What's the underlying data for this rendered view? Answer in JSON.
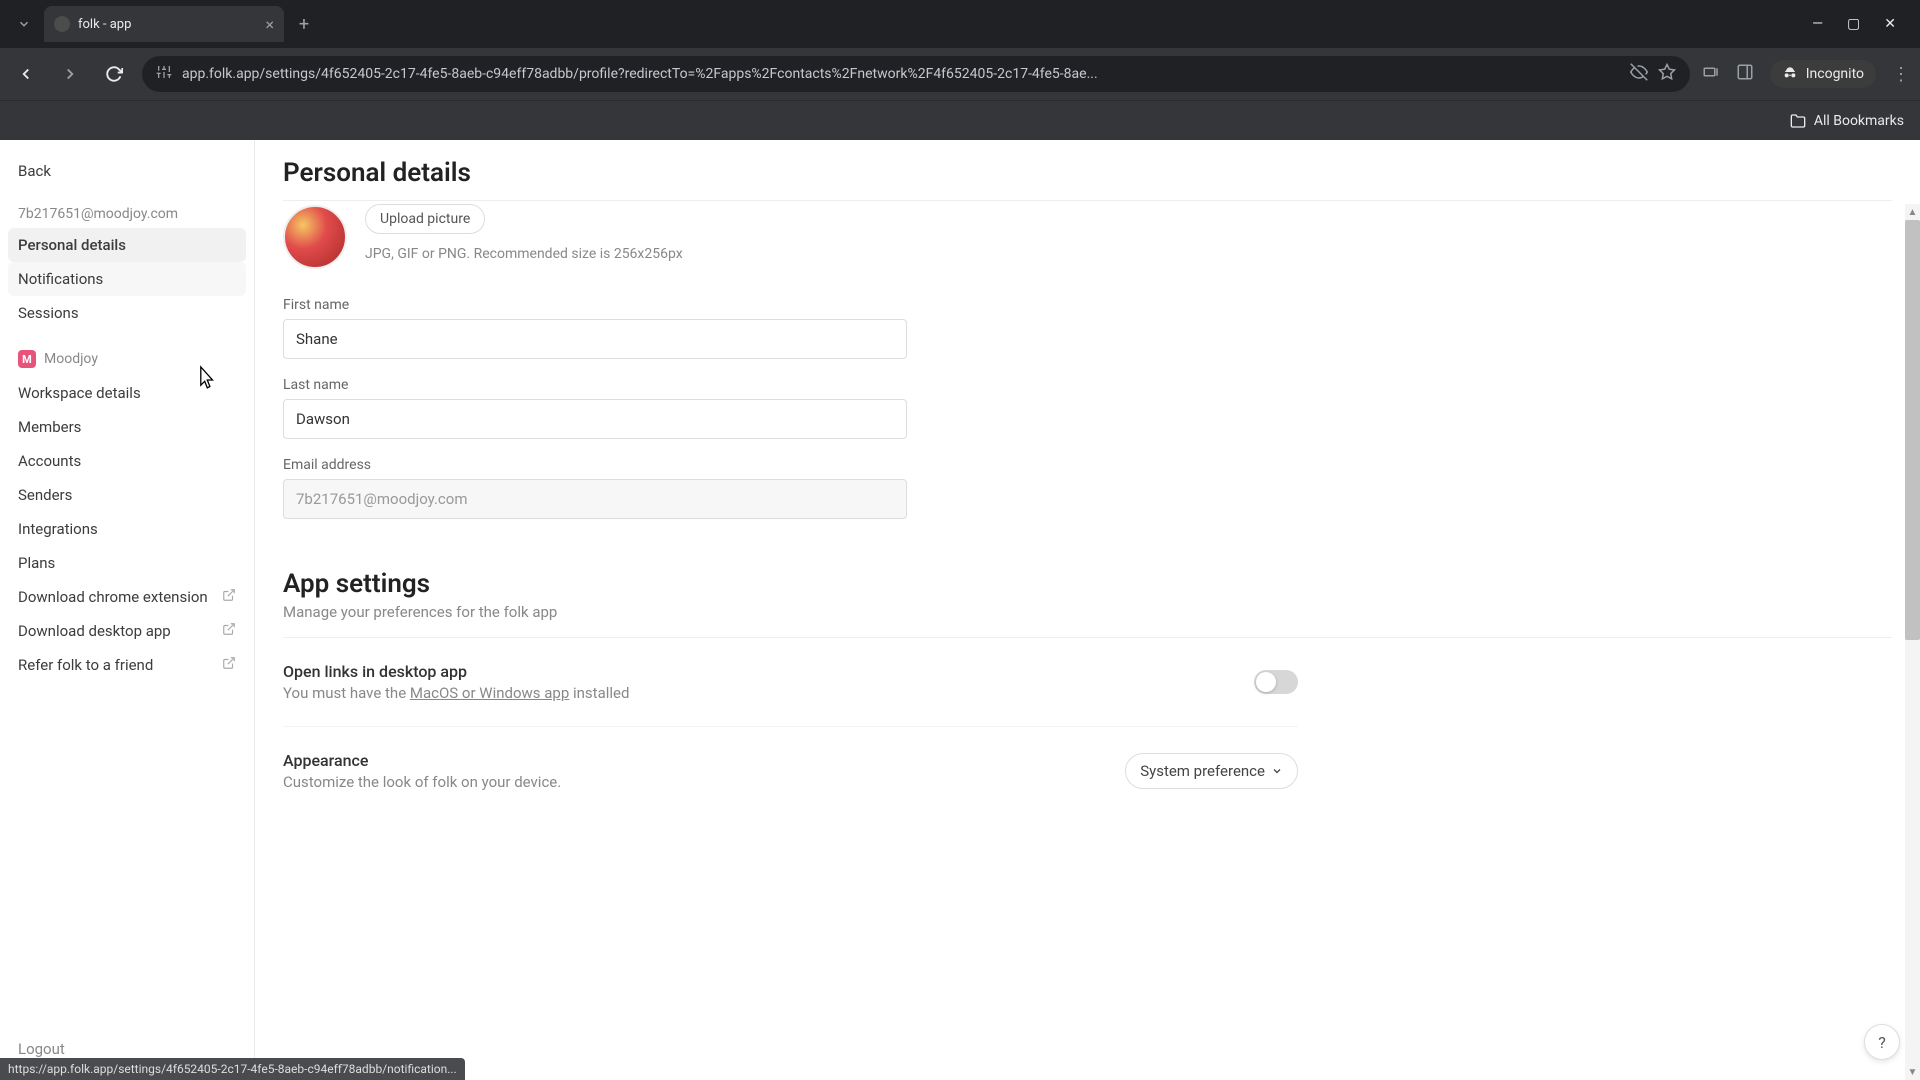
{
  "browser": {
    "tab_title": "folk - app",
    "url": "app.folk.app/settings/4f652405-2c17-4fe5-8aeb-c94eff78adbb/profile?redirectTo=%2Fapps%2Fcontacts%2Fnetwork%2F4f652405-2c17-4fe5-8ae...",
    "incognito_label": "Incognito",
    "all_bookmarks": "All Bookmarks"
  },
  "sidebar": {
    "back": "Back",
    "email": "7b217651@moodjoy.com",
    "personal_items": [
      "Personal details",
      "Notifications",
      "Sessions"
    ],
    "workspace_name": "Moodjoy",
    "workspace_initial": "M",
    "workspace_items": [
      "Workspace details",
      "Members",
      "Accounts",
      "Senders",
      "Integrations",
      "Plans",
      "Download chrome extension",
      "Download desktop app",
      "Refer folk to a friend"
    ],
    "logout": "Logout"
  },
  "main": {
    "page_title": "Personal details",
    "upload_button": "Upload picture",
    "upload_hint": "JPG, GIF or PNG. Recommended size is 256x256px",
    "first_name_label": "First name",
    "first_name_value": "Shane",
    "last_name_label": "Last name",
    "last_name_value": "Dawson",
    "email_label": "Email address",
    "email_value": "7b217651@moodjoy.com",
    "app_settings_title": "App settings",
    "app_settings_sub": "Manage your preferences for the folk app",
    "open_links_title": "Open links in desktop app",
    "open_links_desc_prefix": "You must have the ",
    "open_links_link": "MacOS or Windows app",
    "open_links_desc_suffix": " installed",
    "appearance_title": "Appearance",
    "appearance_desc": "Customize the look of folk on your device.",
    "appearance_value": "System preference"
  },
  "status_bar": "https://app.folk.app/settings/4f652405-2c17-4fe5-8aeb-c94eff78adbb/notification...",
  "help_label": "?"
}
